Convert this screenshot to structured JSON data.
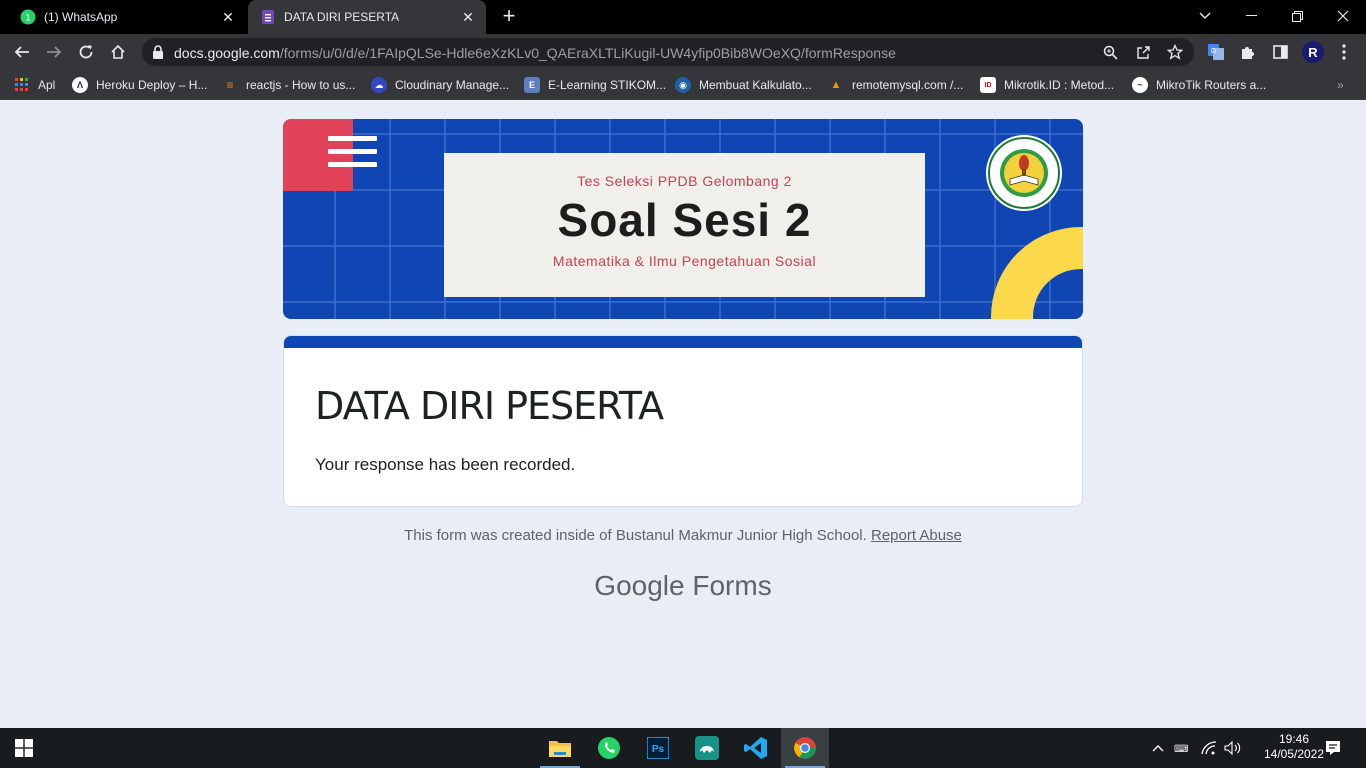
{
  "browser": {
    "tabs": [
      {
        "title": "(1) WhatsApp",
        "icon": "whatsapp-icon",
        "active": false
      },
      {
        "title": "DATA DIRI PESERTA",
        "icon": "google-forms-icon",
        "active": true
      }
    ],
    "address_bar": {
      "host": "docs.google.com",
      "path": "/forms/u/0/d/e/1FAIpQLSe-Hdle6eXzKLv0_QAEraXLTLiKugil-UW4yfip0Bib8WOeXQ/formResponse"
    },
    "profile_initial": "R",
    "bookmarks": [
      {
        "label": "Apl",
        "icon": "apps-grid-icon"
      },
      {
        "label": "Heroku Deploy – H...",
        "icon": "heroku-icon"
      },
      {
        "label": "reactjs - How to us...",
        "icon": "stackoverflow-icon"
      },
      {
        "label": "Cloudinary Manage...",
        "icon": "cloudinary-icon"
      },
      {
        "label": "E-Learning STIKOM...",
        "icon": "elearning-icon"
      },
      {
        "label": "Membuat Kalkulato...",
        "icon": "site-icon"
      },
      {
        "label": "remotemysql.com /...",
        "icon": "phpmyadmin-icon"
      },
      {
        "label": "Mikrotik.ID : Metod...",
        "icon": "mikrotik-id-icon"
      },
      {
        "label": "MikroTik Routers a...",
        "icon": "mikrotik-icon"
      }
    ]
  },
  "banner": {
    "kicker": "Tes Seleksi PPDB Gelombang 2",
    "heading": "Soal Sesi 2",
    "subheading": "Matematika & Ilmu Pengetahuan Sosial",
    "colors": {
      "background": "#0f46b4",
      "accent_red": "#e0425a",
      "accent_yellow": "#fcd94a"
    }
  },
  "form": {
    "title": "DATA DIRI PESERTA",
    "confirmation": "Your response has been recorded."
  },
  "footer": {
    "text": "This form was created inside of Bustanul Makmur Junior High School.",
    "report_link": "Report Abuse",
    "brand_google": "Google",
    "brand_forms": "Forms"
  },
  "taskbar": {
    "apps": [
      "file-explorer-icon",
      "whatsapp-icon",
      "photoshop-icon",
      "gitkraken-icon",
      "vscode-icon",
      "chrome-icon"
    ],
    "time": "19:46",
    "date": "14/05/2022"
  }
}
